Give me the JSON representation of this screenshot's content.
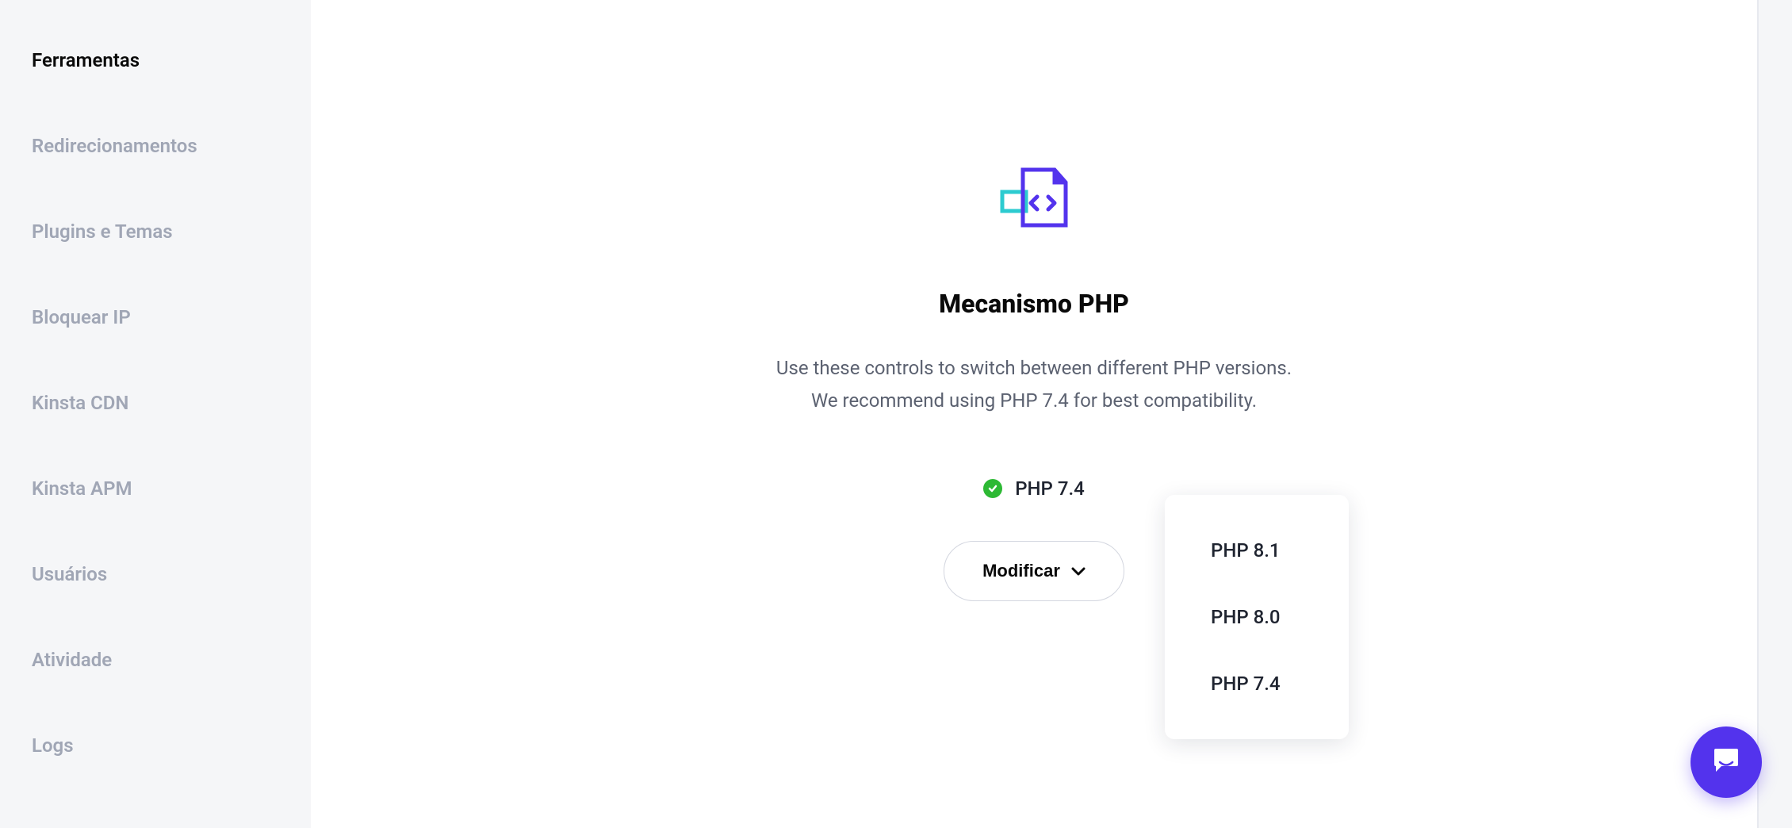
{
  "sidebar": {
    "items": [
      {
        "label": "Ferramentas",
        "active": true
      },
      {
        "label": "Redirecionamentos",
        "active": false
      },
      {
        "label": "Plugins e Temas",
        "active": false
      },
      {
        "label": "Bloquear IP",
        "active": false
      },
      {
        "label": "Kinsta CDN",
        "active": false
      },
      {
        "label": "Kinsta APM",
        "active": false
      },
      {
        "label": "Usuários",
        "active": false
      },
      {
        "label": "Atividade",
        "active": false
      },
      {
        "label": "Logs",
        "active": false
      }
    ]
  },
  "card": {
    "title": "Mecanismo PHP",
    "description": "Use these controls to switch between different PHP versions. We recommend using PHP 7.4 for best compatibility.",
    "status_label": "PHP 7.4",
    "modify_label": "Modificar"
  },
  "dropdown": {
    "options": [
      {
        "label": "PHP 8.1"
      },
      {
        "label": "PHP 8.0"
      },
      {
        "label": "PHP 7.4"
      }
    ]
  }
}
